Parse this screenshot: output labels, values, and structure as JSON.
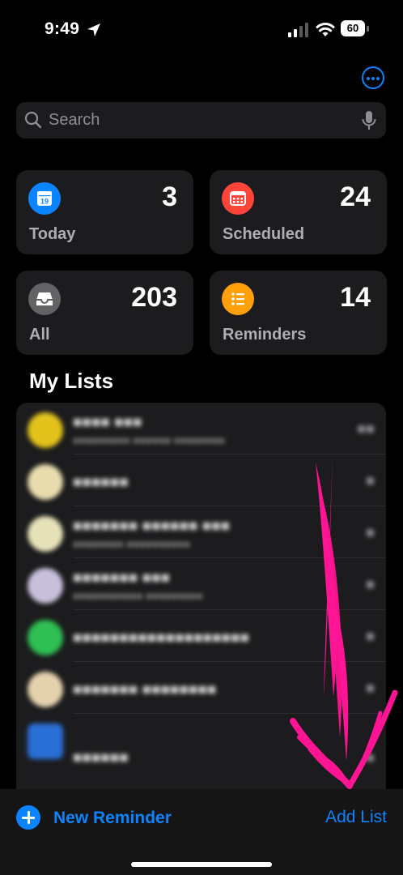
{
  "status_bar": {
    "time": "9:49",
    "battery": "60",
    "icons": [
      "location-arrow-icon",
      "cellular-signal-icon",
      "wifi-icon",
      "battery-icon"
    ]
  },
  "toolbar": {
    "more_icon": "ellipsis-circle-icon"
  },
  "search": {
    "placeholder": "Search",
    "value": "",
    "icon": "search-icon",
    "mic_icon": "mic-icon"
  },
  "smart_lists": [
    {
      "label": "Today",
      "count": "3",
      "icon": "calendar-day-icon",
      "icon_text": "19",
      "color": "#0a84ff"
    },
    {
      "label": "Scheduled",
      "count": "24",
      "icon": "calendar-grid-icon",
      "color": "#ff453a"
    },
    {
      "label": "All",
      "count": "203",
      "icon": "tray-icon",
      "color": "#636366"
    },
    {
      "label": "Reminders",
      "count": "14",
      "icon": "list-bullet-icon",
      "color": "#ff9f0a"
    }
  ],
  "my_lists": {
    "title": "My Lists",
    "redacted": true,
    "items": [
      {
        "icon_color": "#e3c21c"
      },
      {
        "icon_color": "#e8dcae"
      },
      {
        "icon_color": "#e6e2b8"
      },
      {
        "icon_color": "#c9c0dc"
      },
      {
        "icon_color": "#2fbf52"
      },
      {
        "icon_color": "#e4d2ad"
      },
      {
        "icon_color": "#2a6fd6"
      }
    ]
  },
  "annotation": {
    "color": "#ff1493"
  },
  "bottom_bar": {
    "new_reminder": "New Reminder",
    "add_list": "Add List"
  },
  "colors": {
    "accent": "#0a84ff",
    "background": "#000000",
    "card": "#1c1c1e"
  }
}
